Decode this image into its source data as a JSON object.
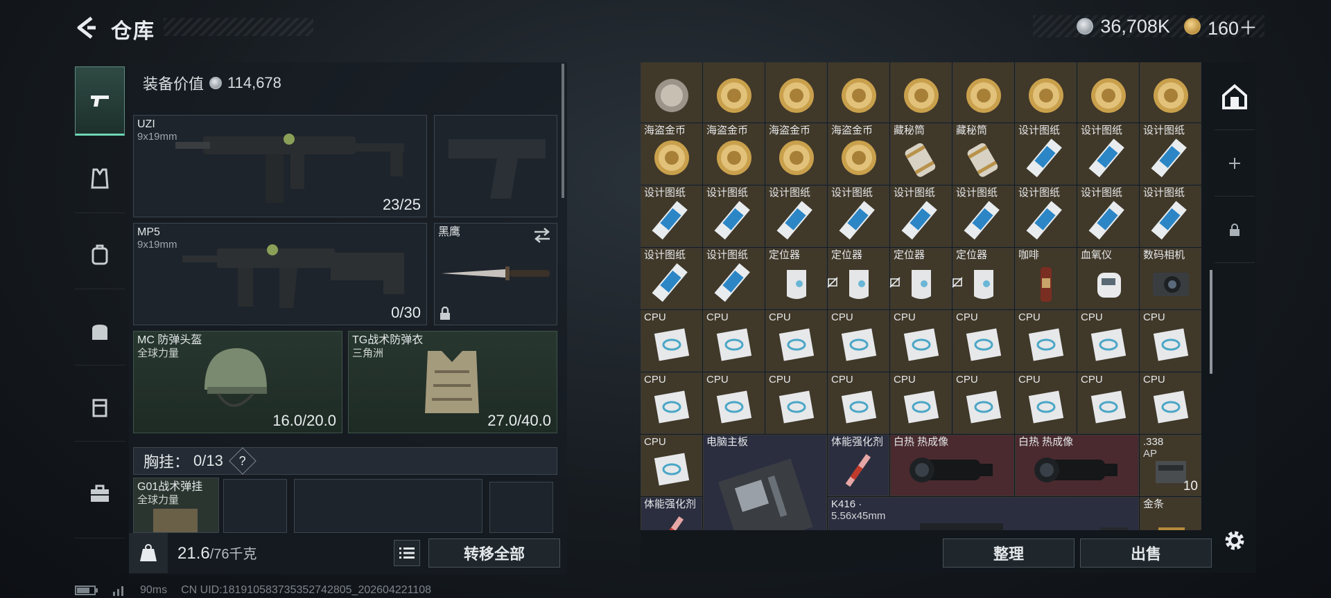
{
  "header": {
    "title": "仓库",
    "currency_silver": "36,708K",
    "currency_gold": "160＋"
  },
  "equipment": {
    "value_label": "装备价值",
    "value": "114,678",
    "weapon1": {
      "name": "UZI",
      "caliber": "9x19mm",
      "ammo": "23/25"
    },
    "weapon2": {
      "name": "MP5",
      "caliber": "9x19mm",
      "ammo": "0/30"
    },
    "melee": {
      "name": "黑鹰"
    },
    "helmet": {
      "name": "MC 防弹头盔",
      "maker": "全球力量",
      "durability": "16.0/20.0"
    },
    "armor": {
      "name": "TG战术防弹衣",
      "maker": "三角洲",
      "durability": "27.0/40.0"
    },
    "chest_rig": {
      "label": "胸挂：",
      "capacity": "0/13",
      "help": "?"
    },
    "rig_item": {
      "name": "G01战术弹挂",
      "maker": "全球力量"
    },
    "weight": {
      "current": "21.6",
      "max": "/76千克"
    },
    "transfer_all": "转移全部"
  },
  "storage": {
    "items": [
      {
        "label": ""
      },
      {
        "label": ""
      },
      {
        "label": ""
      },
      {
        "label": ""
      },
      {
        "label": ""
      },
      {
        "label": ""
      },
      {
        "label": ""
      },
      {
        "label": ""
      },
      {
        "label": ""
      },
      {
        "label": "海盗金币"
      },
      {
        "label": "海盗金币"
      },
      {
        "label": "海盗金币"
      },
      {
        "label": "海盗金币"
      },
      {
        "label": "藏秘筒"
      },
      {
        "label": "藏秘筒"
      },
      {
        "label": "设计图纸"
      },
      {
        "label": "设计图纸"
      },
      {
        "label": "设计图纸"
      },
      {
        "label": "设计图纸"
      },
      {
        "label": "设计图纸"
      },
      {
        "label": "设计图纸"
      },
      {
        "label": "设计图纸"
      },
      {
        "label": "设计图纸"
      },
      {
        "label": "设计图纸"
      },
      {
        "label": "设计图纸"
      },
      {
        "label": "设计图纸"
      },
      {
        "label": "设计图纸"
      },
      {
        "label": "设计图纸"
      },
      {
        "label": "设计图纸"
      },
      {
        "label": "定位器"
      },
      {
        "label": "定位器"
      },
      {
        "label": "定位器"
      },
      {
        "label": "定位器"
      },
      {
        "label": "咖啡"
      },
      {
        "label": "血氧仪"
      },
      {
        "label": "数码相机"
      },
      {
        "label": "CPU"
      },
      {
        "label": "CPU"
      },
      {
        "label": "CPU"
      },
      {
        "label": "CPU"
      },
      {
        "label": "CPU"
      },
      {
        "label": "CPU"
      },
      {
        "label": "CPU"
      },
      {
        "label": "CPU"
      },
      {
        "label": "CPU"
      },
      {
        "label": "CPU"
      },
      {
        "label": "CPU"
      },
      {
        "label": "CPU"
      },
      {
        "label": "CPU"
      },
      {
        "label": "CPU"
      },
      {
        "label": "CPU"
      },
      {
        "label": "CPU"
      },
      {
        "label": "CPU"
      },
      {
        "label": "CPU"
      },
      {
        "label": "CPU"
      },
      {
        "label": "电脑主板"
      },
      {
        "label": "体能强化剂"
      },
      {
        "label": "白热 热成像"
      },
      {
        "label": "白热 热成像"
      },
      {
        "label": ".338",
        "sub": "AP",
        "count": "10"
      },
      {
        "label": "体能强化剂"
      },
      {
        "label": "K416 ·",
        "sub": "5.56x45mm"
      },
      {
        "label": "金条"
      }
    ],
    "sort_label": "整理",
    "sell_label": "出售"
  },
  "status": {
    "ping": "90ms",
    "uid": "CN UID:181910583735352742805_202604221108"
  },
  "icons": {
    "back": "back-arrow-icon",
    "nav": [
      "pistol-icon",
      "vest-icon",
      "backpack-icon",
      "bag-icon",
      "container-icon",
      "toolbox-icon"
    ],
    "right_nav": [
      "storage-home-icon",
      "plus-icon",
      "lock-icon"
    ],
    "settings": "gear-icon"
  }
}
